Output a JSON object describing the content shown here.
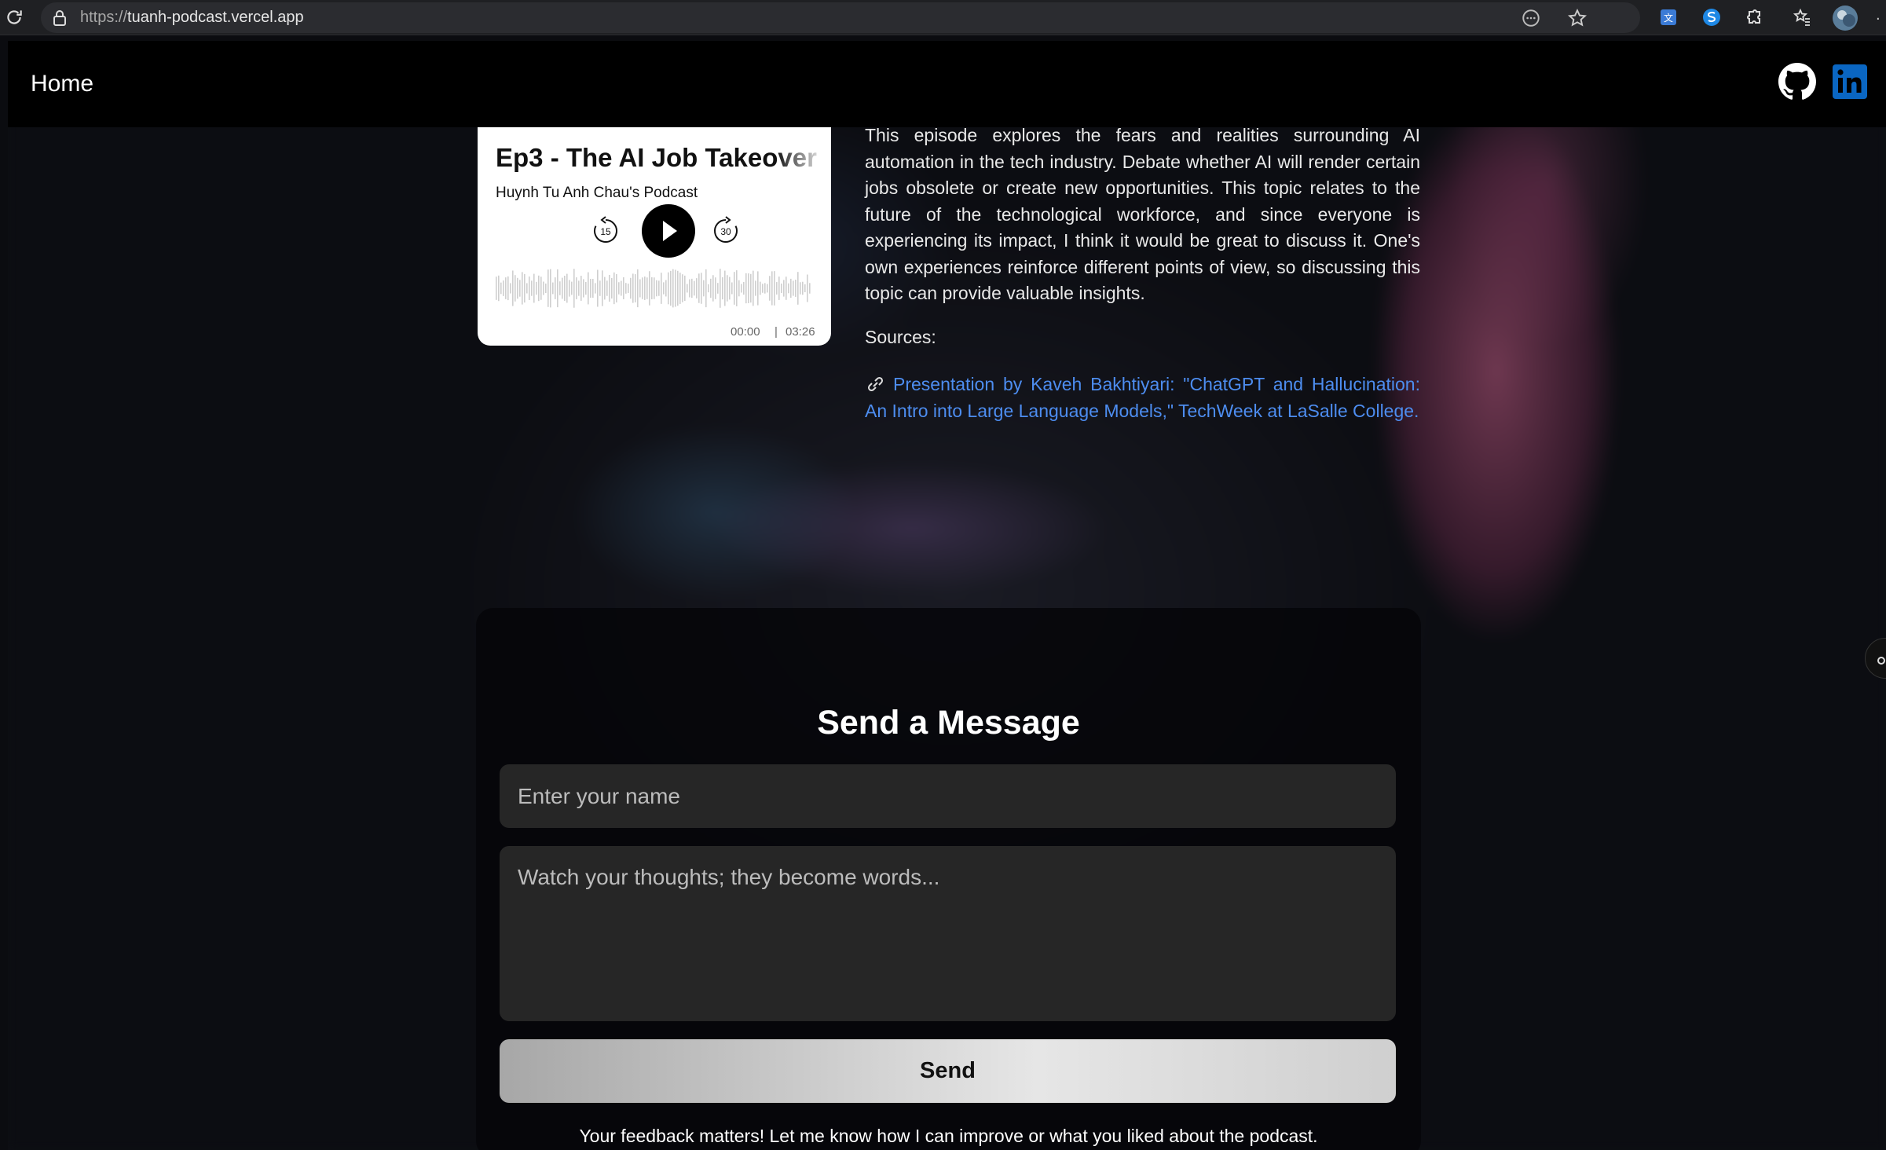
{
  "browser": {
    "url_protocol": "https://",
    "url_host": "tuanh-podcast.vercel.app"
  },
  "nav": {
    "home_label": "Home"
  },
  "player": {
    "episode_title": "Ep3 - The AI Job Takeover",
    "podcast_name": "Huynh Tu Anh Chau's Podcast",
    "skip_back_label": "15",
    "skip_forward_label": "30",
    "current_time": "00:00",
    "separator": "|",
    "duration": "03:26"
  },
  "episode": {
    "description": "This episode explores the fears and realities surrounding AI automation in the tech industry. Debate whether AI will render certain jobs obsolete or create new opportunities. This topic relates to the future of the technological workforce, and since everyone is experiencing its impact, I think it would be great to discuss it. One's own experiences reinforce different points of view, so discussing this topic can provide valuable insights.",
    "sources_label": "Sources:",
    "source_link_text": "Presentation by Kaveh Bakhtiyari: \"ChatGPT and Hallucination: An Intro into Large Language Models,\" TechWeek at LaSalle College."
  },
  "contact": {
    "title": "Send a Message",
    "name_placeholder": "Enter your name",
    "message_placeholder": "Watch your thoughts; they become words...",
    "send_label": "Send",
    "feedback_text": "Your feedback matters! Let me know how I can improve or what you liked about the podcast."
  },
  "colors": {
    "link": "#4d8df0",
    "linkedin": "#0a66c2",
    "page_bg": "#0e0f14"
  },
  "icons": [
    "reload-icon",
    "lock-icon",
    "reader-mode-icon",
    "star-icon",
    "extension-translate-icon",
    "extension-s-icon",
    "extensions-icon",
    "favorites-icon",
    "profile-avatar-icon",
    "github-icon",
    "linkedin-icon",
    "skip-back-icon",
    "play-icon",
    "skip-forward-icon",
    "link-icon",
    "side-panel-icon"
  ]
}
